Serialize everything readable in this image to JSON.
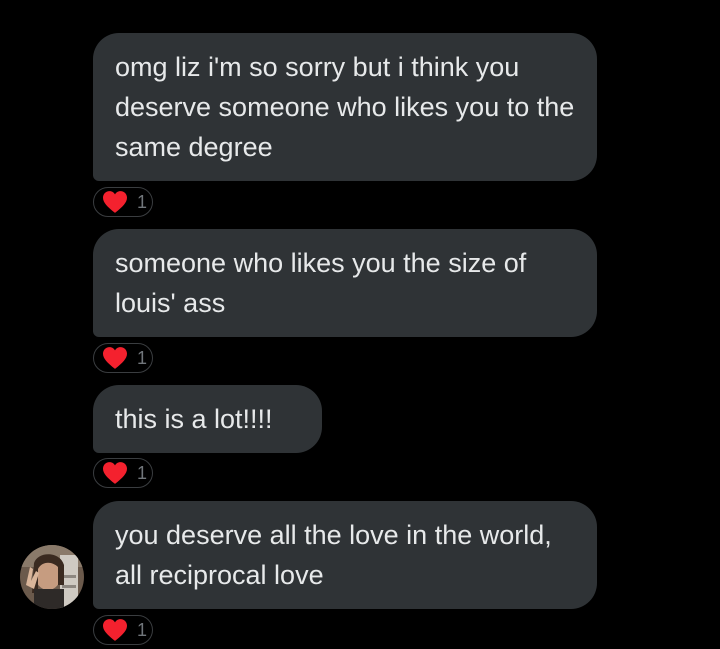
{
  "messages": [
    {
      "text": "omg liz i'm so sorry but i think you deserve someone who likes you to the same degree",
      "reaction": {
        "icon": "heart-icon",
        "count": "1"
      }
    },
    {
      "text": "someone who likes you the size of louis' ass",
      "reaction": {
        "icon": "heart-icon",
        "count": "1"
      }
    },
    {
      "text": "this is a lot!!!!",
      "reaction": {
        "icon": "heart-icon",
        "count": "1"
      }
    },
    {
      "text": "you deserve all the love in the world, all reciprocal love",
      "reaction": {
        "icon": "heart-icon",
        "count": "1"
      }
    }
  ],
  "colors": {
    "background": "#000000",
    "bubble": "#2f3336",
    "text": "#e7e9ea",
    "heart": "#f91880",
    "count": "#71767b"
  }
}
